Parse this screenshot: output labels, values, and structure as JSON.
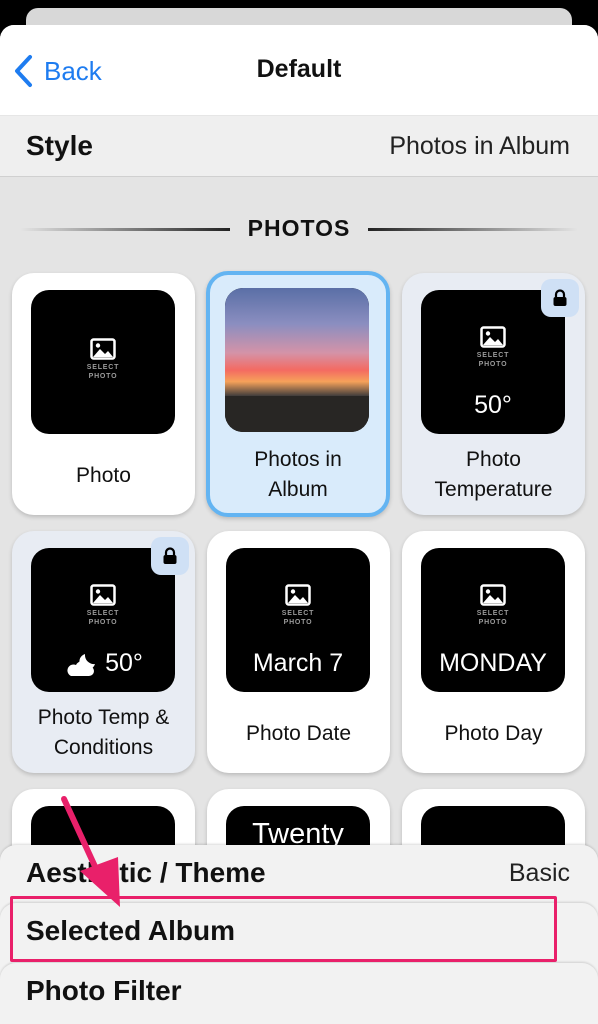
{
  "navbar": {
    "back_label": "Back",
    "title": "Default"
  },
  "style_row": {
    "label": "Style",
    "value": "Photos in Album"
  },
  "section": {
    "title": "PHOTOS"
  },
  "photo_placeholder": {
    "line1": "SELECT",
    "line2": "PHOTO"
  },
  "cards": [
    {
      "label": "Photo",
      "overlay": ""
    },
    {
      "label_line1": "Photos in",
      "label_line2": "Album"
    },
    {
      "label_line1": "Photo",
      "label_line2": "Temperature",
      "overlay": "50°"
    },
    {
      "label_line1": "Photo Temp &",
      "label_line2": "Conditions",
      "overlay": "50°"
    },
    {
      "label": "Photo Date",
      "overlay": "March 7"
    },
    {
      "label": "Photo Day",
      "overlay": "MONDAY"
    }
  ],
  "partial_row": {
    "middle_text": "Twenty"
  },
  "bottom_panel": {
    "theme_label": "Aesthetic / Theme",
    "theme_value": "Basic",
    "album_label": "Selected Album",
    "filter_label": "Photo Filter"
  },
  "colors": {
    "accent": "#1e7cf0",
    "selected_border": "#63b4f2",
    "annotation": "#e9206a"
  }
}
